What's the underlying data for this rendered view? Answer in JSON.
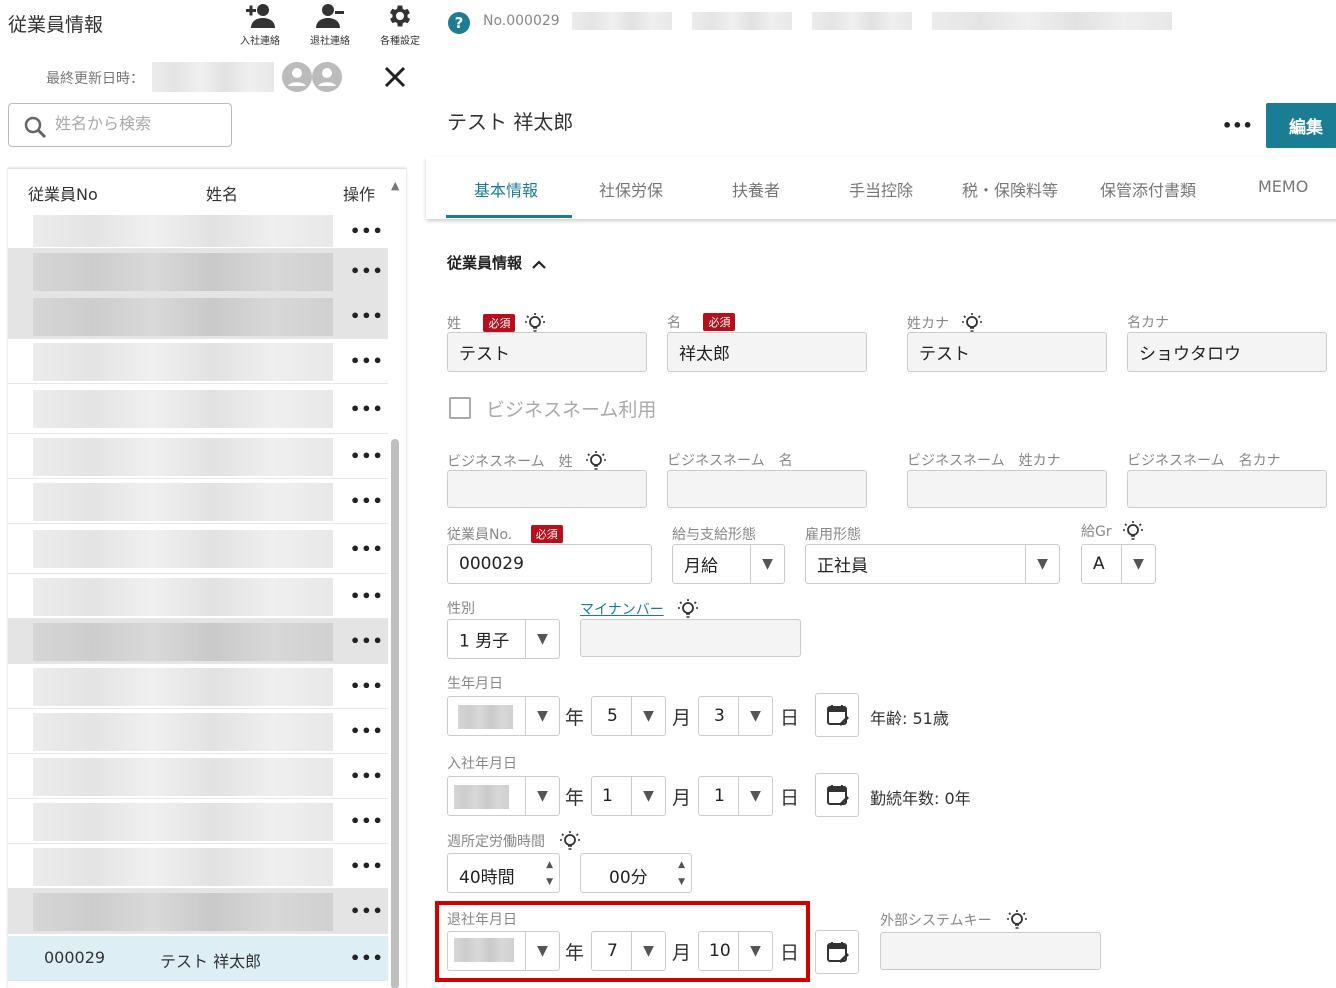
{
  "app": {
    "title": "従業員情報"
  },
  "toolbar": [
    {
      "label": "入社連絡",
      "icon": "person-add-icon"
    },
    {
      "label": "退社連絡",
      "icon": "person-remove-icon"
    },
    {
      "label": "各種設定",
      "icon": "gear-icon"
    }
  ],
  "last_updated": {
    "label": "最終更新日時："
  },
  "search": {
    "placeholder": "姓名から検索"
  },
  "list": {
    "headers": {
      "no": "従業員No",
      "name": "姓名",
      "action": "操作"
    },
    "rows_visible": 17,
    "selected": {
      "no": "000029",
      "name": "テスト 祥太郎"
    },
    "row_action": "•••"
  },
  "header": {
    "help_icon": "question-circle-icon",
    "employee_no": "No.000029",
    "name": "テスト 祥太郎",
    "more": "•••",
    "edit_label": "編集"
  },
  "tabs": [
    "基本情報",
    "社保労保",
    "扶養者",
    "手当控除",
    "税・保険料等",
    "保管添付書類",
    "MEMO"
  ],
  "active_tab": "基本情報",
  "section": {
    "title": "従業員情報"
  },
  "labels": {
    "required": "必須",
    "sei": "姓",
    "mei": "名",
    "sei_kana": "姓カナ",
    "mei_kana": "名カナ",
    "business_name_use": "ビジネスネーム利用",
    "bn_sei": "ビジネスネーム　姓",
    "bn_mei": "ビジネスネーム　名",
    "bn_sei_kana": "ビジネスネーム　姓カナ",
    "bn_mei_kana": "ビジネスネーム　名カナ",
    "emp_no": "従業員No.",
    "pay_type": "給与支給形態",
    "employment": "雇用形態",
    "pay_group": "給Gr",
    "gender": "性別",
    "mynumber": "マイナンバー",
    "birth": "生年月日",
    "hire": "入社年月日",
    "weekly_hours": "週所定労働時間",
    "retire": "退社年月日",
    "external_key": "外部システムキー",
    "year": "年",
    "month": "月",
    "day": "日"
  },
  "values": {
    "sei": "テスト",
    "mei": "祥太郎",
    "sei_kana": "テスト",
    "mei_kana": "ショウタロウ",
    "emp_no": "000029",
    "pay_type": "月給",
    "employment": "正社員",
    "pay_group": "A",
    "gender": "1 男子",
    "birth_month": "5",
    "birth_day": "3",
    "age": "年齢: 51歳",
    "hire_month": "1",
    "hire_day": "1",
    "tenure": "勤続年数: 0年",
    "hours": "40時間",
    "minutes": "00分",
    "retire_month": "7",
    "retire_day": "10"
  }
}
